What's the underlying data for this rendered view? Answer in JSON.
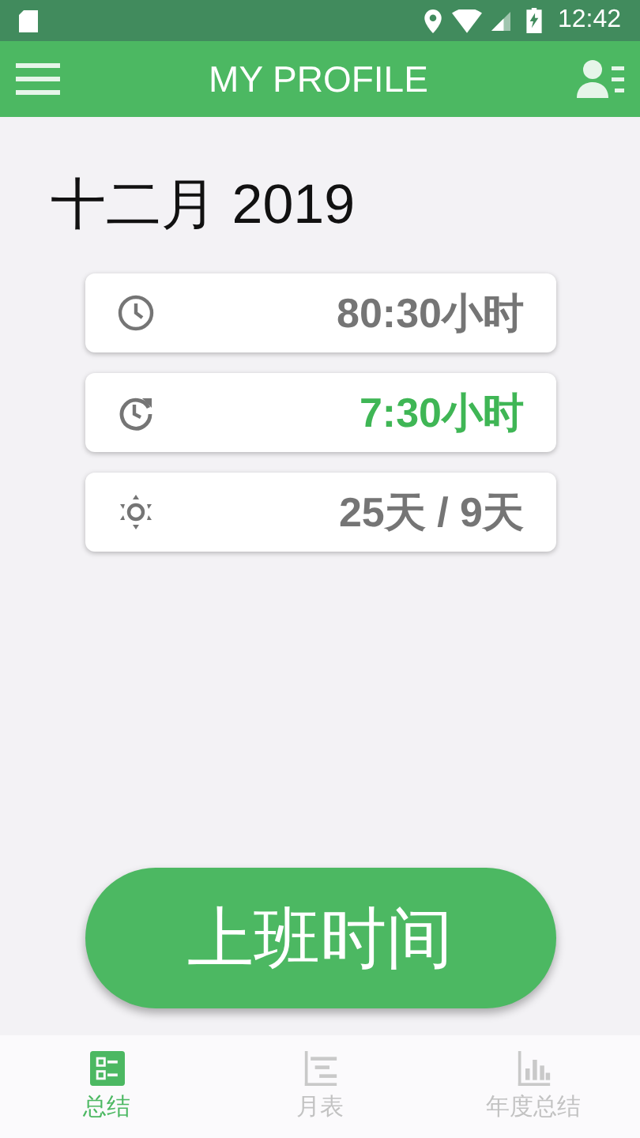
{
  "status_bar": {
    "time": "12:42"
  },
  "app_bar": {
    "title": "MY PROFILE"
  },
  "month_title": "十二月 2019",
  "stats": [
    {
      "kind": "clock",
      "value": "80:30小时",
      "highlighted": false
    },
    {
      "kind": "clock-refresh",
      "value": "7:30小时",
      "highlighted": true
    },
    {
      "kind": "sun",
      "value": "25天 / 9天",
      "highlighted": false
    }
  ],
  "main_button": "上班时间",
  "bottom_nav": [
    {
      "kind": "summary",
      "label": "总结",
      "selected": true
    },
    {
      "kind": "month",
      "label": "月表",
      "selected": false
    },
    {
      "kind": "year",
      "label": "年度总结",
      "selected": false
    }
  ]
}
